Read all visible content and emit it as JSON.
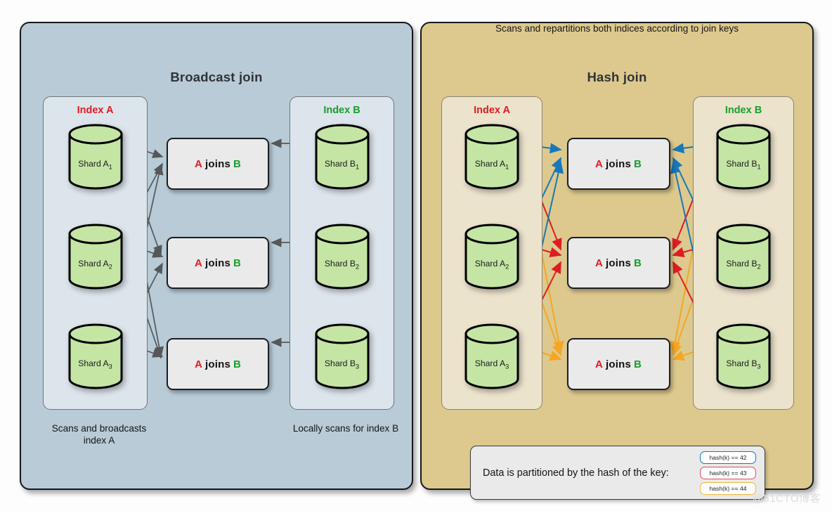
{
  "watermark": "@51CTO博客",
  "colors": {
    "index_a": "#e01b24",
    "index_b": "#16a02c",
    "arrow_gray": "#555759",
    "arrow_blue": "#1878b8",
    "arrow_red": "#e01b24",
    "arrow_orange": "#f5a623",
    "panel_broadcast_bg": "#b8cbd7",
    "panel_hash_bg": "#ddc98e",
    "subpanel_broadcast_bg": "#dde5ec",
    "subpanel_hash_bg": "#ece3cd",
    "cylinder_fill": "#c5e5a5",
    "joinbox_fill": "#eaeaea"
  },
  "broadcast": {
    "title": "Broadcast join",
    "index_a": {
      "label": "Index A",
      "shards": [
        {
          "name": "Shard A",
          "sub": "1"
        },
        {
          "name": "Shard A",
          "sub": "2"
        },
        {
          "name": "Shard A",
          "sub": "3"
        }
      ]
    },
    "index_b": {
      "label": "Index B",
      "shards": [
        {
          "name": "Shard B",
          "sub": "1"
        },
        {
          "name": "Shard B",
          "sub": "2"
        },
        {
          "name": "Shard B",
          "sub": "3"
        }
      ]
    },
    "joins": [
      {
        "a": "A",
        "joins": "joins",
        "b": "B"
      },
      {
        "a": "A",
        "joins": "joins",
        "b": "B"
      },
      {
        "a": "A",
        "joins": "joins",
        "b": "B"
      }
    ],
    "caption_left": "Scans and broadcasts index A",
    "caption_right": "Locally scans for index B"
  },
  "hash": {
    "title": "Hash join",
    "index_a": {
      "label": "Index A",
      "shards": [
        {
          "name": "Shard A",
          "sub": "1"
        },
        {
          "name": "Shard A",
          "sub": "2"
        },
        {
          "name": "Shard A",
          "sub": "3"
        }
      ]
    },
    "index_b": {
      "label": "Index B",
      "shards": [
        {
          "name": "Shard B",
          "sub": "1"
        },
        {
          "name": "Shard B",
          "sub": "2"
        },
        {
          "name": "Shard B",
          "sub": "3"
        }
      ]
    },
    "joins": [
      {
        "a": "A",
        "joins": "joins",
        "b": "B"
      },
      {
        "a": "A",
        "joins": "joins",
        "b": "B"
      },
      {
        "a": "A",
        "joins": "joins",
        "b": "B"
      }
    ],
    "caption": "Scans and repartitions both indices according to join keys",
    "legend": {
      "text": "Data is partitioned by the hash of the key:",
      "badges": [
        {
          "label": "hash(k) == 42",
          "color": "#1878b8"
        },
        {
          "label": "hash(k) == 43",
          "color": "#e04a62"
        },
        {
          "label": "hash(k) == 44",
          "color": "#f5b731"
        }
      ]
    }
  }
}
